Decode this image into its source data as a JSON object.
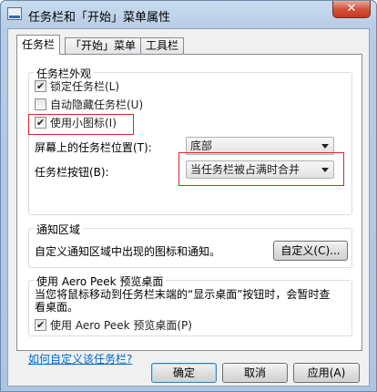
{
  "window": {
    "title": "任务栏和「开始」菜单属性",
    "close_glyph": "✕"
  },
  "tabs": [
    {
      "label": "任务栏"
    },
    {
      "label": "「开始」菜单"
    },
    {
      "label": "工具栏"
    }
  ],
  "appearance": {
    "group_label": "任务栏外观",
    "lock_taskbar": {
      "label": "锁定任务栏(L)",
      "checked": true
    },
    "auto_hide": {
      "label": "自动隐藏任务栏(U)",
      "checked": false
    },
    "small_icons": {
      "label": "使用小图标(I)",
      "checked": true
    },
    "location_label": "屏幕上的任务栏位置(T):",
    "location_value": "底部",
    "buttons_label": "任务栏按钮(B):",
    "buttons_value": "当任务栏被占满时合并"
  },
  "notification": {
    "group_label": "通知区域",
    "description": "自定义通知区域中出现的图标和通知。",
    "customize_button": "自定义(C)..."
  },
  "aero_peek": {
    "group_label": "使用 Aero Peek 预览桌面",
    "description": "当您将鼠标移动到任务栏末端的“显示桌面”按钮时，会暂时查看桌面。",
    "checkbox": {
      "label": "使用 Aero Peek 预览桌面(P)",
      "checked": true
    }
  },
  "help_link": "如何自定义该任务栏?",
  "footer": {
    "ok": "确定",
    "cancel": "取消",
    "apply": "应用(A)"
  }
}
